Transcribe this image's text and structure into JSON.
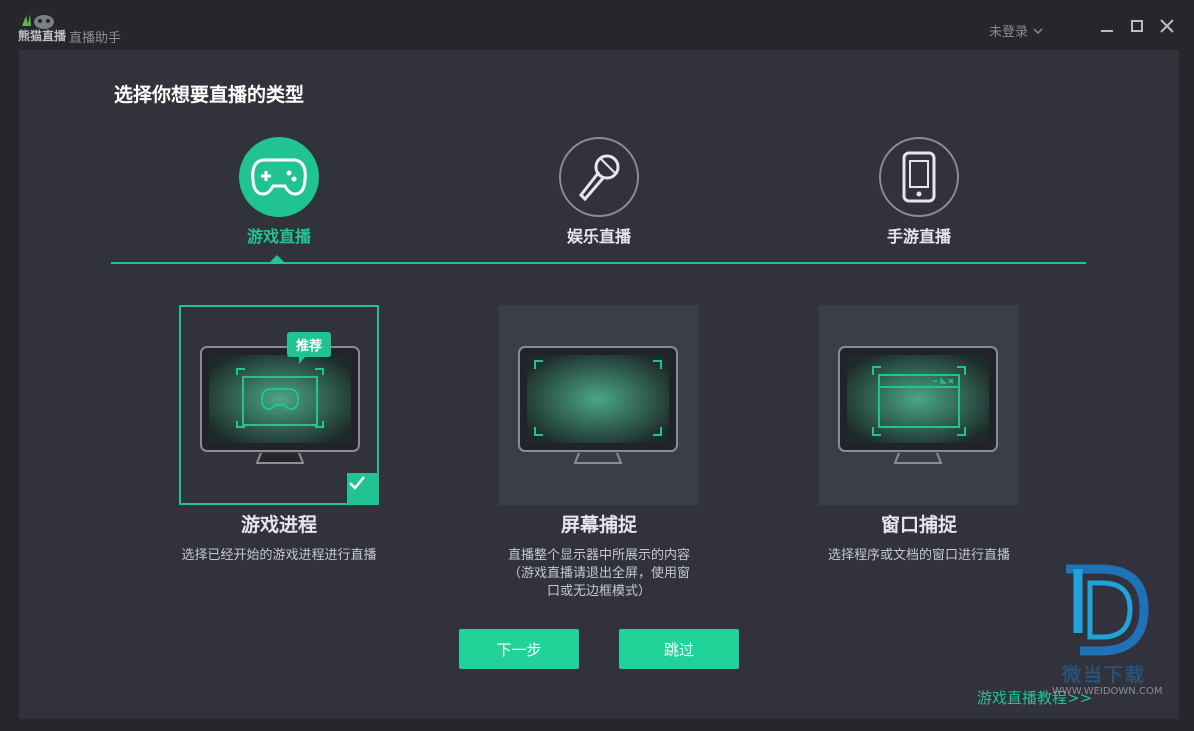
{
  "app": {
    "logo_text": "熊猫直播",
    "subtitle": "直播助手",
    "login_label": "未登录"
  },
  "heading": "选择你想要直播的类型",
  "categories": [
    {
      "label": "游戏直播",
      "icon": "gamepad-icon",
      "active": true
    },
    {
      "label": "娱乐直播",
      "icon": "microphone-icon",
      "active": false
    },
    {
      "label": "手游直播",
      "icon": "phone-icon",
      "active": false
    }
  ],
  "modes": [
    {
      "title": "游戏进程",
      "desc": "选择已经开始的游戏进程进行直播",
      "badge": "推荐",
      "selected": true
    },
    {
      "title": "屏幕捕捉",
      "desc": "直播整个显示器中所展示的内容",
      "desc2": "（游戏直播请退出全屏，使用窗",
      "desc3": "口或无边框模式）",
      "selected": false
    },
    {
      "title": "窗口捕捉",
      "desc": "选择程序或文档的窗口进行直播",
      "selected": false
    }
  ],
  "buttons": {
    "next": "下一步",
    "skip": "跳过"
  },
  "tutorial_link": "游戏直播教程>>",
  "watermark": {
    "text": "微当下载",
    "url": "WWW.WEIDOWN.COM"
  },
  "colors": {
    "accent": "#21c491",
    "panel": "#31323c",
    "frame": "#26262b"
  }
}
